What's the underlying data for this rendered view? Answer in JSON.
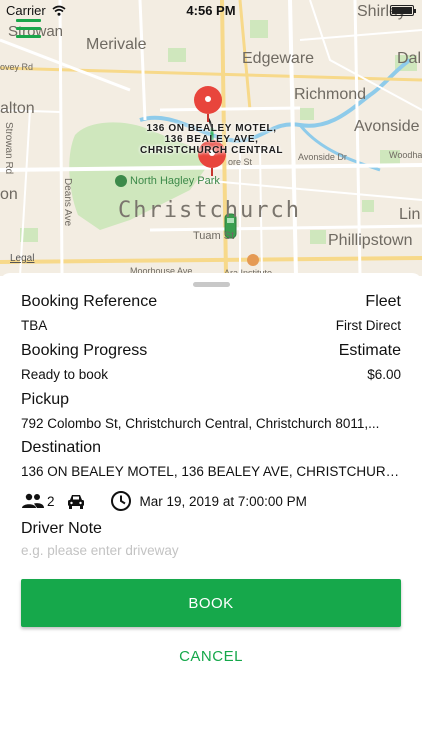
{
  "status_bar": {
    "carrier": "Carrier",
    "time": "4:56 PM"
  },
  "map": {
    "labels": {
      "sumner": "Strowan",
      "shirley": "Shirley",
      "merivale": "Merivale",
      "edgeware": "Edgeware",
      "dallington": "Dall",
      "ovey_rd": "ovey Rd",
      "richmond": "Richmond",
      "avonside": "Avonside",
      "riccarton": "alton",
      "avonside_dr": "Avonside Dr",
      "woodham": "Woodha",
      "strowan_rd": "Strowan Rd",
      "deans_ave": "Deans Ave",
      "north_hagley_park": "North Hagley Park",
      "addington": "on",
      "christchurch": "Christchurch",
      "linwood": "Lin",
      "tuam_st": "Tuam St",
      "phillipstown": "Phillipstown",
      "moorhouse_ave": "Moorhouse Ave",
      "ara_institute": "Ara Institute",
      "gloucester": "ore St"
    },
    "pin_label": "136 ON BEALEY MOTEL,\n136 BEALEY AVE,\nCHRISTCHURCH CENTRAL",
    "legal": "Legal"
  },
  "booking": {
    "reference_label": "Booking Reference",
    "reference_value": "TBA",
    "fleet_label": "Fleet",
    "fleet_value": "First Direct",
    "progress_label": "Booking Progress",
    "progress_value": "Ready to book",
    "estimate_label": "Estimate",
    "estimate_value": "$6.00",
    "pickup_label": "Pickup",
    "pickup_value": "792 Colombo St, Christchurch Central, Christchurch 8011,...",
    "destination_label": "Destination",
    "destination_value": "136 ON BEALEY MOTEL, 136 BEALEY AVE, CHRISTCHURCH...",
    "passengers": "2",
    "datetime": "Mar 19, 2019 at 7:00:00 PM",
    "driver_note_label": "Driver Note",
    "driver_note_placeholder": "e.g. please enter driveway",
    "book_label": "BOOK",
    "cancel_label": "CANCEL"
  },
  "colors": {
    "accent": "#16a84b",
    "pin": "#e8453c"
  }
}
